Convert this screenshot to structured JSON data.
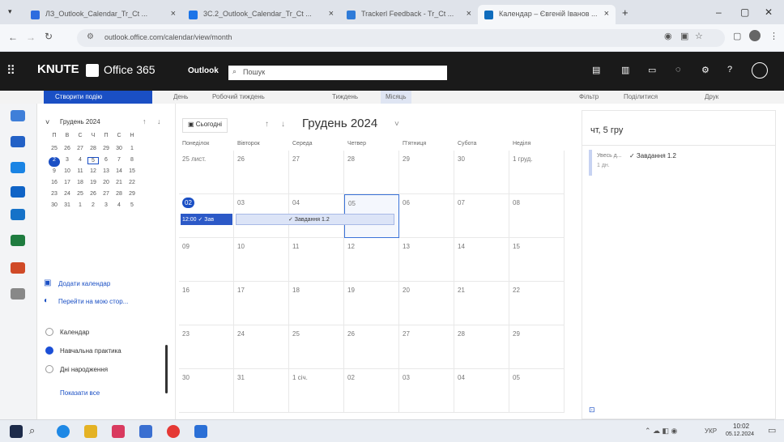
{
  "browser": {
    "tabs": [
      {
        "label": "ЛЗ_Outlook_Calendar_Tr_Ct ...",
        "color": "#2d6cdf"
      },
      {
        "label": "3C.2_Outlook_Calendar_Tr_Ct ...",
        "color": "#1b74e8"
      },
      {
        "label": "Trackerl Feedback - Tr_Ct ...",
        "color": "#2f7bd8"
      },
      {
        "label": "Календар – Євгеній Іванов ...",
        "color": "#0f6cbd"
      }
    ],
    "url": "outlook.office.com/calendar/view/month"
  },
  "header": {
    "org": "KNUTE",
    "suite": "Office 365",
    "app": "Outlook",
    "search_placeholder": "Пошук"
  },
  "commandbar": {
    "new_event": "Створити подію",
    "items": [
      "День",
      "Робочий тиждень",
      "Тиждень",
      "Місяць"
    ],
    "right_items": [
      "Фільтр",
      "Поділитися",
      "Друк"
    ]
  },
  "leftpane": {
    "month_label": "Грудень 2024",
    "weekdays": [
      "П",
      "В",
      "С",
      "Ч",
      "П",
      "С",
      "Н"
    ],
    "weeks": [
      [
        "25",
        "26",
        "27",
        "28",
        "29",
        "30",
        "1"
      ],
      [
        "2",
        "3",
        "4",
        "5",
        "6",
        "7",
        "8"
      ],
      [
        "9",
        "10",
        "11",
        "12",
        "13",
        "14",
        "15"
      ],
      [
        "16",
        "17",
        "18",
        "19",
        "20",
        "21",
        "22"
      ],
      [
        "23",
        "24",
        "25",
        "26",
        "27",
        "28",
        "29"
      ],
      [
        "30",
        "31",
        "1",
        "2",
        "3",
        "4",
        "5"
      ]
    ],
    "add_calendar": "Додати календар",
    "go_to_my_page": "Перейти на мою стор...",
    "calendars": [
      {
        "label": "Календар",
        "checked": false,
        "color": "#999999"
      },
      {
        "label": "Навчальна практика",
        "checked": true,
        "color": "#1b4fd6"
      },
      {
        "label": "Дні народження",
        "checked": false,
        "color": "#999999"
      }
    ],
    "show_all": "Показати все"
  },
  "calendar": {
    "today_button": "Сьогодні",
    "month_title": "Грудень 2024",
    "columns": [
      "Понеділок",
      "Вівторок",
      "Середа",
      "Четвер",
      "П’ятниця",
      "Субота",
      "Неділя"
    ],
    "weeks": [
      [
        "25 лист.",
        "26",
        "27",
        "28",
        "29",
        "30",
        "1 груд."
      ],
      [
        "02",
        "03",
        "04",
        "05",
        "06",
        "07",
        "08"
      ],
      [
        "09",
        "10",
        "11",
        "12",
        "13",
        "14",
        "15"
      ],
      [
        "16",
        "17",
        "18",
        "19",
        "20",
        "21",
        "22"
      ],
      [
        "23",
        "24",
        "25",
        "26",
        "27",
        "28",
        "29"
      ],
      [
        "30",
        "31",
        "1 січ.",
        "02",
        "03",
        "04",
        "05"
      ]
    ],
    "event_short": "12:00 ✓ Зав",
    "event_bar": "✓ Завдання 1.2"
  },
  "rightpane": {
    "date_title": "чт, 5 гру",
    "event_time": "Увесь д...",
    "event_duration": "1 дн.",
    "event_title": "✓ Завдання 1.2"
  },
  "taskbar": {
    "lang": "УКР",
    "time": "10:02",
    "date": "05.12.2024"
  }
}
